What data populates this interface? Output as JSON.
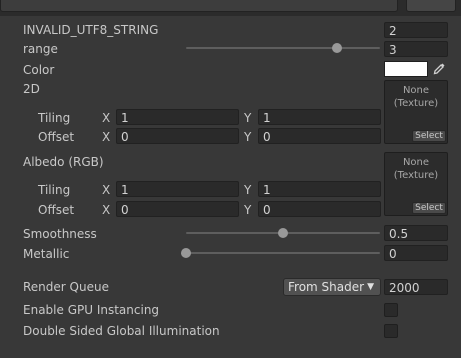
{
  "colors": {
    "panel_bg": "#383838",
    "field_bg": "#2a2a2a",
    "color_swatch": "#FFFFFF"
  },
  "properties": {
    "invalid_label": "INVALID_UTF8_STRING",
    "invalid_value": "2",
    "range_label": "range",
    "range_value": "3",
    "range_slider_level": 0.78,
    "color_label": "Color",
    "section_2d_label": "2D",
    "tiling_label": "Tiling",
    "offset_label": "Offset",
    "x_axis": "X",
    "y_axis": "Y",
    "tex2d_tiling_x": "1",
    "tex2d_tiling_y": "1",
    "tex2d_offset_x": "0",
    "tex2d_offset_y": "0",
    "texture_none_line1": "None",
    "texture_none_line2": "(Texture)",
    "select_label": "Select",
    "albedo_label": "Albedo (RGB)",
    "albedo_tiling_x": "1",
    "albedo_tiling_y": "1",
    "albedo_offset_x": "0",
    "albedo_offset_y": "0",
    "smoothness_label": "Smoothness",
    "smoothness_value": "0.5",
    "smoothness_level": 0.5,
    "metallic_label": "Metallic",
    "metallic_value": "0",
    "metallic_level": 0,
    "render_queue_label": "Render Queue",
    "render_queue_mode": "From Shader",
    "render_queue_value": "2000",
    "gpu_instancing_label": "Enable GPU Instancing",
    "gpu_instancing_checked": false,
    "double_sided_gi_label": "Double Sided Global Illumination",
    "double_sided_gi_checked": false
  },
  "icons": {
    "color_picker": "eyedropper-icon",
    "dropdown_arrow": "triangle-down-icon"
  }
}
